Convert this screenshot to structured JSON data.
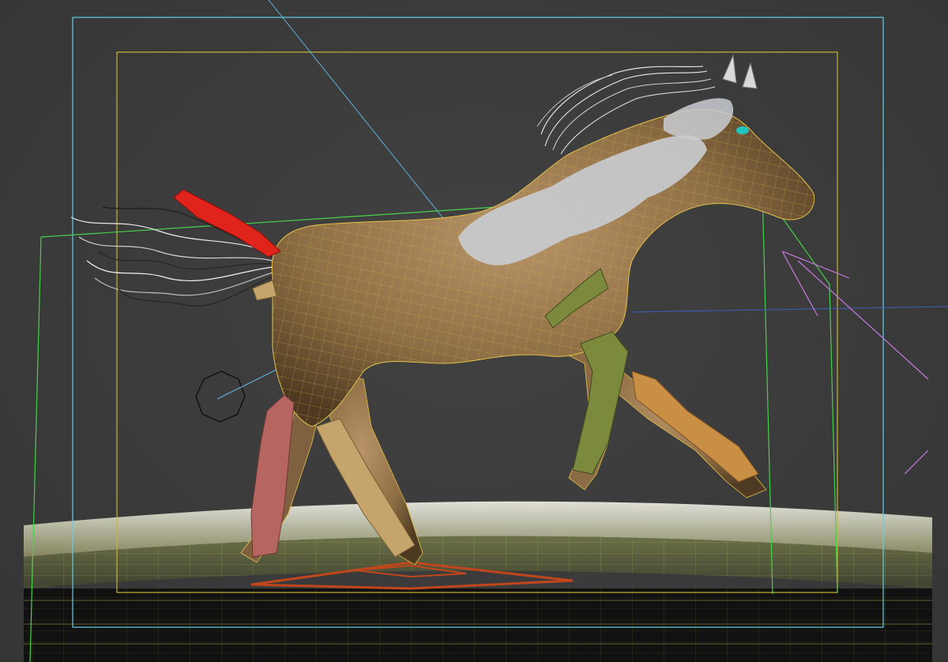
{
  "viewport": {
    "background": "#3b3b3b",
    "safe_frame_outer_color": "#5fd0e6",
    "safe_frame_inner_color": "#c9b536",
    "camera_frustum_color": "#46d14a",
    "grid_color": "#d7d96a"
  },
  "scene": {
    "horse_mesh_color": "#9a7a4c",
    "wireframe_color": "#e2c24a",
    "patch_color": "#c9ccd2",
    "bone_colors": {
      "rear_left_leg": "#b76561",
      "rear_right_leg": "#c6a56c",
      "front_left_leg": "#7b8a3d",
      "front_right_leg": "#c98f45",
      "tail": "#e0241c"
    },
    "icons": [
      "point-helper-icon",
      "footstep-icon",
      "light-icon"
    ]
  }
}
